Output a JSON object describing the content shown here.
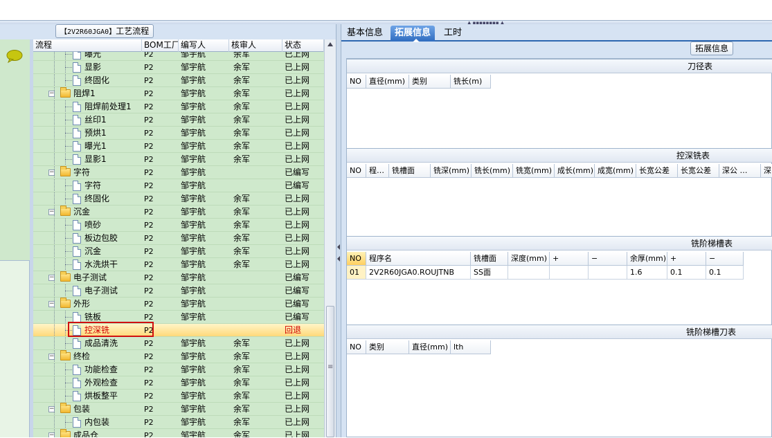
{
  "left": {
    "title_tag": "【2V2R60JGA0】",
    "title_text": "工艺流程",
    "columns": [
      "流程",
      "BOM工厂",
      "编写人",
      "核审人",
      "状态"
    ],
    "rows": [
      {
        "name": "曝光",
        "bom": "P2",
        "writer": "邹宇航",
        "reviewer": "余军",
        "status": "已上网",
        "level": 2,
        "type": "doc"
      },
      {
        "name": "显影",
        "bom": "P2",
        "writer": "邹宇航",
        "reviewer": "余军",
        "status": "已上网",
        "level": 2,
        "type": "doc"
      },
      {
        "name": "终固化",
        "bom": "P2",
        "writer": "邹宇航",
        "reviewer": "余军",
        "status": "已上网",
        "level": 2,
        "type": "doc"
      },
      {
        "name": "阻焊1",
        "bom": "P2",
        "writer": "邹宇航",
        "reviewer": "余军",
        "status": "已上网",
        "level": 1,
        "type": "folder"
      },
      {
        "name": "阻焊前处理1",
        "bom": "P2",
        "writer": "邹宇航",
        "reviewer": "余军",
        "status": "已上网",
        "level": 2,
        "type": "doc"
      },
      {
        "name": "丝印1",
        "bom": "P2",
        "writer": "邹宇航",
        "reviewer": "余军",
        "status": "已上网",
        "level": 2,
        "type": "doc"
      },
      {
        "name": "预烘1",
        "bom": "P2",
        "writer": "邹宇航",
        "reviewer": "余军",
        "status": "已上网",
        "level": 2,
        "type": "doc"
      },
      {
        "name": "曝光1",
        "bom": "P2",
        "writer": "邹宇航",
        "reviewer": "余军",
        "status": "已上网",
        "level": 2,
        "type": "doc"
      },
      {
        "name": "显影1",
        "bom": "P2",
        "writer": "邹宇航",
        "reviewer": "余军",
        "status": "已上网",
        "level": 2,
        "type": "doc"
      },
      {
        "name": "字符",
        "bom": "P2",
        "writer": "邹宇航",
        "reviewer": "",
        "status": "已编写",
        "level": 1,
        "type": "folder"
      },
      {
        "name": "字符",
        "bom": "P2",
        "writer": "邹宇航",
        "reviewer": "",
        "status": "已编写",
        "level": 2,
        "type": "doc"
      },
      {
        "name": "终固化",
        "bom": "P2",
        "writer": "邹宇航",
        "reviewer": "余军",
        "status": "已上网",
        "level": 2,
        "type": "doc"
      },
      {
        "name": "沉金",
        "bom": "P2",
        "writer": "邹宇航",
        "reviewer": "余军",
        "status": "已上网",
        "level": 1,
        "type": "folder"
      },
      {
        "name": "喷砂",
        "bom": "P2",
        "writer": "邹宇航",
        "reviewer": "余军",
        "status": "已上网",
        "level": 2,
        "type": "doc"
      },
      {
        "name": "板边包胶",
        "bom": "P2",
        "writer": "邹宇航",
        "reviewer": "余军",
        "status": "已上网",
        "level": 2,
        "type": "doc"
      },
      {
        "name": "沉金",
        "bom": "P2",
        "writer": "邹宇航",
        "reviewer": "余军",
        "status": "已上网",
        "level": 2,
        "type": "doc"
      },
      {
        "name": "水洗烘干",
        "bom": "P2",
        "writer": "邹宇航",
        "reviewer": "余军",
        "status": "已上网",
        "level": 2,
        "type": "doc"
      },
      {
        "name": "电子测试",
        "bom": "P2",
        "writer": "邹宇航",
        "reviewer": "",
        "status": "已编写",
        "level": 1,
        "type": "folder"
      },
      {
        "name": "电子测试",
        "bom": "P2",
        "writer": "邹宇航",
        "reviewer": "",
        "status": "已编写",
        "level": 2,
        "type": "doc"
      },
      {
        "name": "外形",
        "bom": "P2",
        "writer": "邹宇航",
        "reviewer": "",
        "status": "已编写",
        "level": 1,
        "type": "folder"
      },
      {
        "name": "铣板",
        "bom": "P2",
        "writer": "邹宇航",
        "reviewer": "",
        "status": "已编写",
        "level": 2,
        "type": "doc"
      },
      {
        "name": "控深铣",
        "bom": "P2",
        "writer": "",
        "reviewer": "",
        "status": "回退",
        "level": 2,
        "type": "doc",
        "selected": true
      },
      {
        "name": "成品清洗",
        "bom": "P2",
        "writer": "邹宇航",
        "reviewer": "余军",
        "status": "已上网",
        "level": 2,
        "type": "doc"
      },
      {
        "name": "终检",
        "bom": "P2",
        "writer": "邹宇航",
        "reviewer": "余军",
        "status": "已上网",
        "level": 1,
        "type": "folder"
      },
      {
        "name": "功能检查",
        "bom": "P2",
        "writer": "邹宇航",
        "reviewer": "余军",
        "status": "已上网",
        "level": 2,
        "type": "doc"
      },
      {
        "name": "外观检查",
        "bom": "P2",
        "writer": "邹宇航",
        "reviewer": "余军",
        "status": "已上网",
        "level": 2,
        "type": "doc"
      },
      {
        "name": "烘板整平",
        "bom": "P2",
        "writer": "邹宇航",
        "reviewer": "余军",
        "status": "已上网",
        "level": 2,
        "type": "doc"
      },
      {
        "name": "包装",
        "bom": "P2",
        "writer": "邹宇航",
        "reviewer": "余军",
        "status": "已上网",
        "level": 1,
        "type": "folder"
      },
      {
        "name": "内包装",
        "bom": "P2",
        "writer": "邹宇航",
        "reviewer": "余军",
        "status": "已上网",
        "level": 2,
        "type": "doc"
      },
      {
        "name": "成品仓",
        "bom": "P2",
        "writer": "邹宇航",
        "reviewer": "余军",
        "status": "已上网",
        "level": 1,
        "type": "folder"
      }
    ]
  },
  "right": {
    "tabs": [
      "基本信息",
      "拓展信息",
      "工时"
    ],
    "active_tab": 1,
    "sub_title": "拓展信息",
    "sections": [
      {
        "caption": "刀径表",
        "columns": [
          "NO",
          "直径(mm)",
          "类别",
          "铣长(m)"
        ],
        "rows": []
      },
      {
        "caption": "控深铣表",
        "columns": [
          "NO",
          "程…",
          "铣槽面",
          "铣深(mm)",
          "铣长(mm)",
          "铣宽(mm)",
          "成长(mm)",
          "成宽(mm)",
          "长宽公差",
          "长宽公差",
          "深公 …",
          "深"
        ],
        "rows": []
      },
      {
        "caption": "铣阶梯槽表",
        "columns": [
          "NO",
          "程序名",
          "铣槽面",
          "深度(mm)",
          "+",
          "−",
          "余厚(mm)",
          "+",
          "−"
        ],
        "rows": [
          [
            "01",
            "2V2R60JGA0.ROUJTNB",
            "SS面",
            "",
            "",
            "",
            "1.6",
            "0.1",
            "0.1"
          ]
        ]
      },
      {
        "caption": "铣阶梯槽刀表",
        "columns": [
          "NO",
          "类别",
          "直径(mm)",
          "lth"
        ],
        "rows": []
      }
    ]
  },
  "colors": {
    "tree_bg": "#cfe9cc",
    "accent_tab": "#2f6cc0",
    "selection_border": "#d01010",
    "returned_status": "#d00000"
  }
}
